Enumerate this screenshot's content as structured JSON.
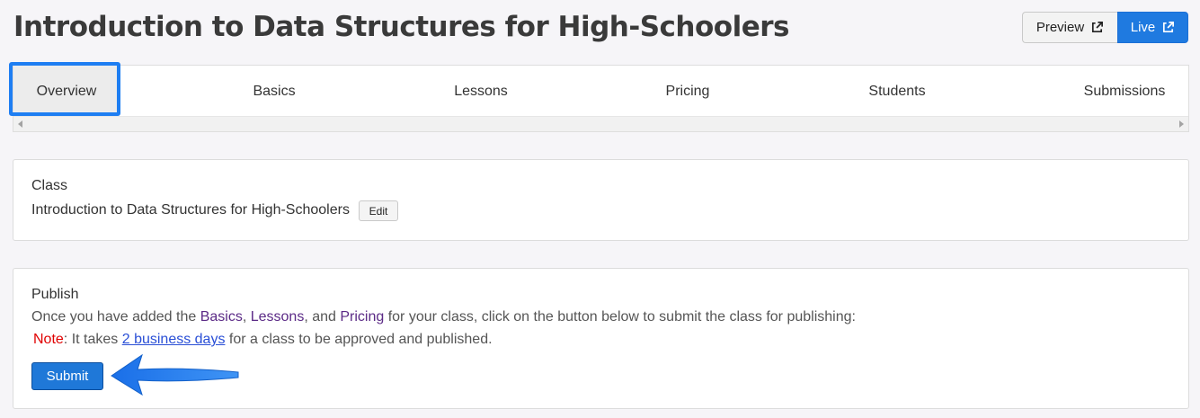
{
  "header": {
    "title": "Introduction to Data Structures for High-Schoolers",
    "preview_label": "Preview",
    "live_label": "Live",
    "preview_icon": "external-link-icon",
    "live_icon": "external-link-icon"
  },
  "tabs": [
    {
      "label": "Overview",
      "active": true
    },
    {
      "label": "Basics"
    },
    {
      "label": "Lessons"
    },
    {
      "label": "Pricing"
    },
    {
      "label": "Students"
    },
    {
      "label": "Submissions"
    }
  ],
  "class_card": {
    "heading": "Class",
    "name": "Introduction to Data Structures for High-Schoolers",
    "edit_label": "Edit"
  },
  "publish_card": {
    "heading": "Publish",
    "text_prefix": "Once you have added the ",
    "basics": "Basics",
    "comma": ", ",
    "lessons": "Lessons",
    "and": ", and ",
    "pricing": "Pricing",
    "text_suffix": " for your class, click on the button below to submit the class for publishing:",
    "note_label": "Note",
    "note_colon": ": It takes ",
    "note_link": "2 business days",
    "note_suffix": " for a class to be approved and published.",
    "submit_label": "Submit"
  },
  "colors": {
    "accent": "#1f7ae0",
    "highlight": "#1e7ef2",
    "note": "#e00000",
    "link": "#2a4fd6",
    "purple_link": "#5b2a86"
  }
}
